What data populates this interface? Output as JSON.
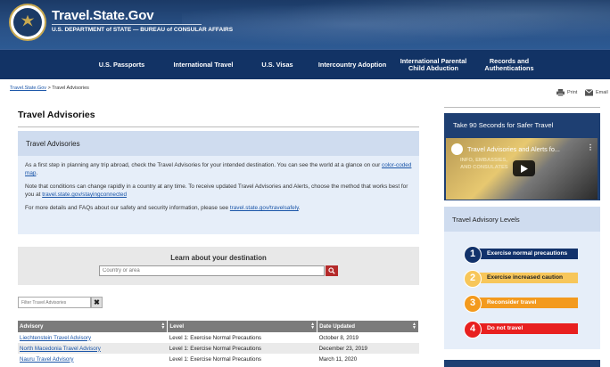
{
  "header": {
    "site_title": "Travel.State.Gov",
    "site_subtitle": "U.S. DEPARTMENT of STATE — BUREAU of CONSULAR AFFAIRS"
  },
  "nav": {
    "items": [
      {
        "label": "U.S. Passports"
      },
      {
        "label": "International Travel"
      },
      {
        "label": "U.S. Visas"
      },
      {
        "label": "Intercountry Adoption"
      },
      {
        "label": "International Parental Child Abduction"
      },
      {
        "label": "Records and Authentications"
      }
    ]
  },
  "breadcrumb": {
    "home": "Travel.State.Gov",
    "separator": " > ",
    "current": "Travel Advisories"
  },
  "page_actions": {
    "print": "Print",
    "email": "Email"
  },
  "main": {
    "title": "Travel Advisories",
    "advisory_box": {
      "heading": "Travel Advisories",
      "p1_text": "As a first step in planning any trip abroad, check the Travel Advisories for your intended destination. You can see the world at a glance on our ",
      "p1_link": "color-coded map",
      "p1_end": ".",
      "p2_text": "Note that conditions can change rapidly in a country at any time. To receive updated Travel Advisories and Alerts, choose the method that works best for you at ",
      "p2_link": "travel.state.gov/stayingconnected",
      "p3_text": "For more details and FAQs about our safety and security information, please see ",
      "p3_link": "travel.state.gov/travelsafely",
      "p3_end": "."
    },
    "learn": {
      "title": "Learn about your destination",
      "placeholder": "Country or area"
    },
    "filter": {
      "placeholder": "Filter Travel Advisories",
      "clear": "✖"
    },
    "table": {
      "headers": [
        "Advisory",
        "Level",
        "Date Updated"
      ],
      "rows": [
        {
          "advisory": "Liechtenstein Travel Advisory",
          "level": "Level 1: Exercise Normal Precautions",
          "date": "October 8, 2019"
        },
        {
          "advisory": "North Macedonia Travel Advisory",
          "level": "Level 1: Exercise Normal Precautions",
          "date": "December 23, 2019"
        },
        {
          "advisory": "Nauru Travel Advisory",
          "level": "Level 1: Exercise Normal Precautions",
          "date": "March 11, 2020"
        }
      ]
    }
  },
  "sidebar": {
    "video_card": {
      "title": "Take 90 Seconds for Safer Travel",
      "video_title": "Travel Advisories and Alerts fo...",
      "video_caption_1": "INFO, EMBASSIES,",
      "video_caption_2": "AND CONSULATES"
    },
    "levels_card": {
      "title": "Travel Advisory Levels",
      "levels": [
        {
          "num": "1",
          "label": "Exercise normal precautions",
          "color": "#12326b",
          "text_color": "#ffffff"
        },
        {
          "num": "2",
          "label": "Exercise increased caution",
          "color": "#f7c65a",
          "text_color": "#222222"
        },
        {
          "num": "3",
          "label": "Reconsider travel",
          "color": "#f39a1e",
          "text_color": "#ffffff"
        },
        {
          "num": "4",
          "label": "Do not travel",
          "color": "#e8201f",
          "text_color": "#ffffff"
        }
      ]
    }
  },
  "colors": {
    "header_blue": "#1b3a66",
    "nav_blue": "#123365",
    "link_blue": "#1a55a8",
    "search_red": "#b42a2a"
  }
}
